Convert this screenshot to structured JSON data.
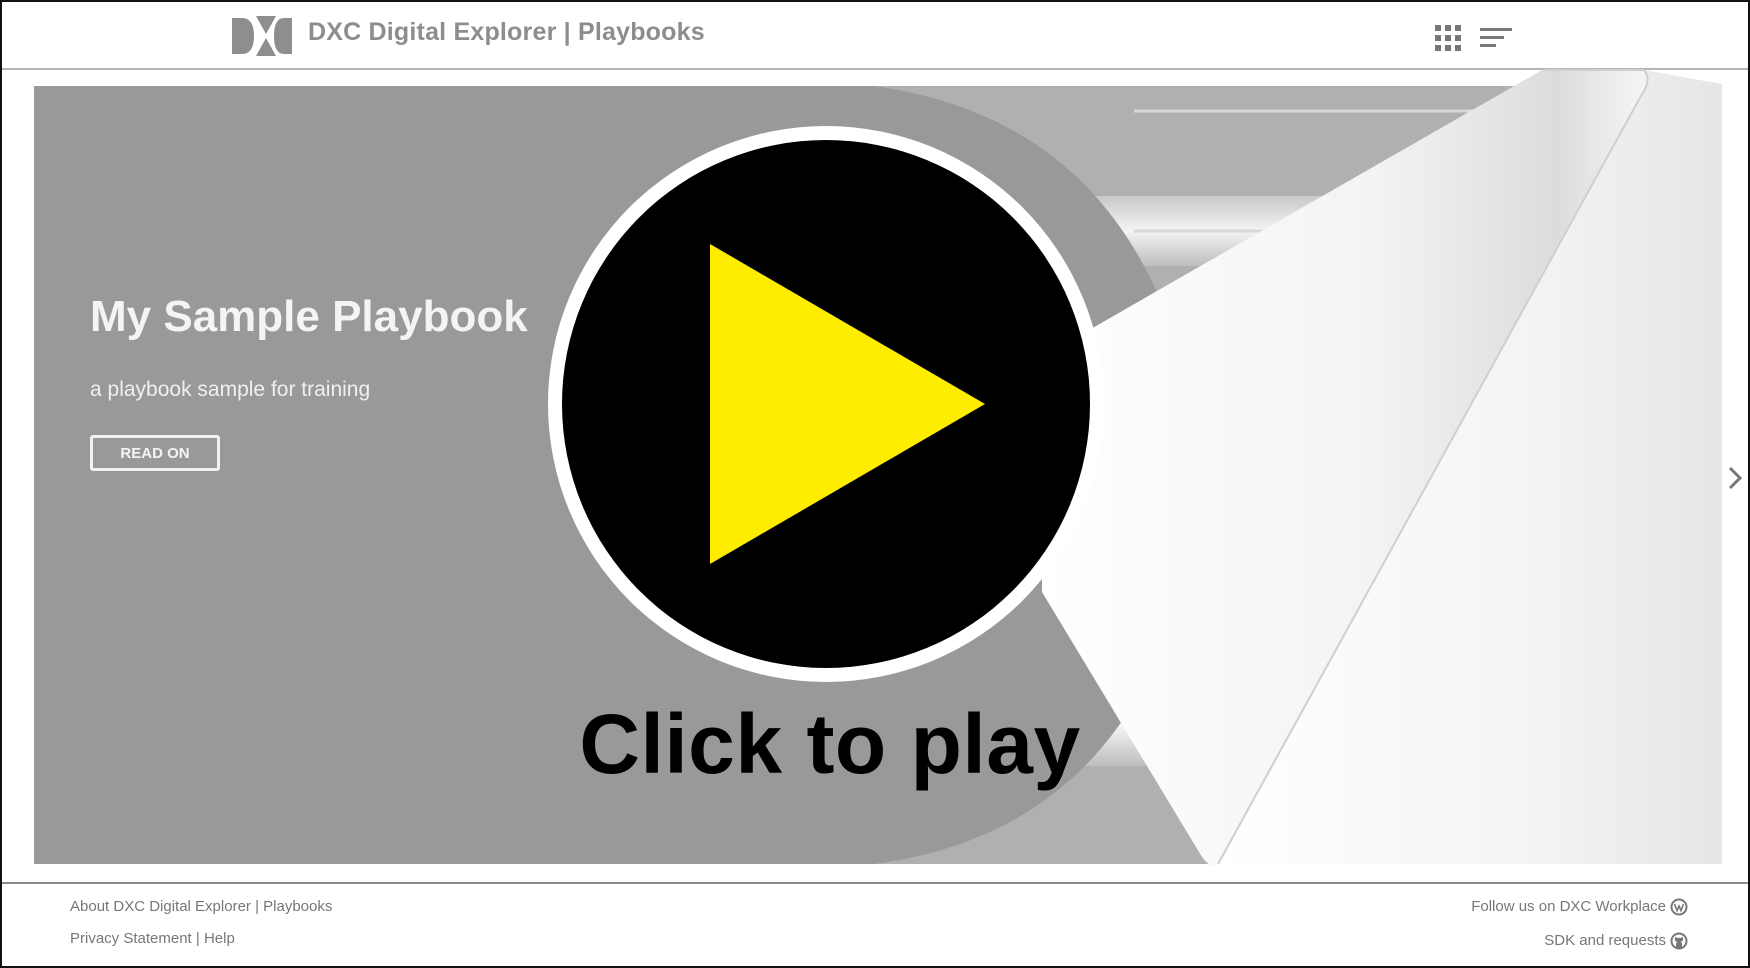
{
  "header": {
    "title": "DXC Digital Explorer | Playbooks",
    "logo_icon": "dxc-logo-icon",
    "apps_icon": "grid-apps-icon",
    "menu_icon": "hamburger-menu-icon"
  },
  "hero": {
    "title": "My Sample Playbook",
    "subtitle": "a playbook sample for training",
    "read_on_label": "READ ON",
    "next_icon": "chevron-right-icon"
  },
  "overlay": {
    "play_label": "Click to play",
    "play_icon": "play-icon",
    "play_color": "#FFED00"
  },
  "footer": {
    "about": "About DXC Digital Explorer | Playbooks",
    "privacy": "Privacy Statement",
    "separator": "|",
    "help": "Help",
    "follow": "Follow us on DXC Workplace",
    "sdk": "SDK and requests",
    "workplace_icon": "workplace-icon",
    "github_icon": "github-icon"
  }
}
